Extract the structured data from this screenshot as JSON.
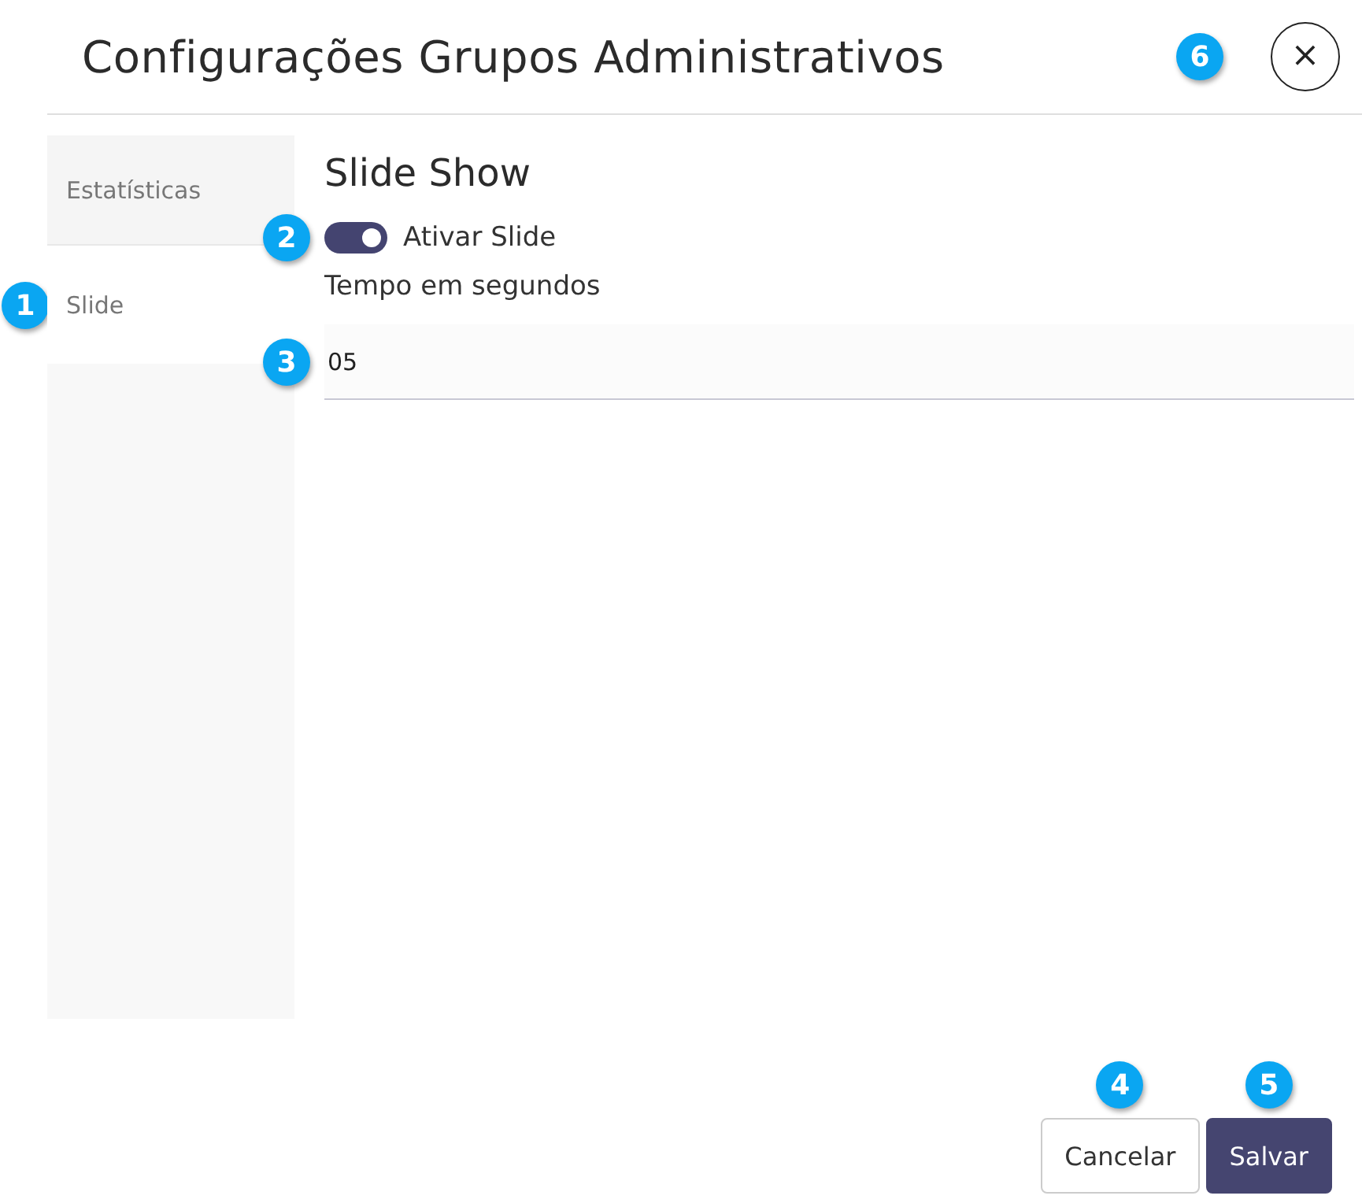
{
  "dialog": {
    "title": "Configurações Grupos Administrativos",
    "close": {
      "label": "×",
      "callout": "6"
    }
  },
  "tabs": [
    {
      "label": "Estatísticas",
      "selected": false
    },
    {
      "label": "Slide",
      "selected": true,
      "callout": "1"
    }
  ],
  "panel": {
    "heading": "Slide Show",
    "toggle": {
      "label": "Ativar Slide",
      "on": true,
      "callout": "2"
    },
    "field": {
      "label": "Tempo em segundos",
      "value": "05",
      "callout": "3"
    }
  },
  "buttons": [
    {
      "label": "Cancelar",
      "kind": "secondary",
      "callout": "4"
    },
    {
      "label": "Salvar",
      "kind": "primary",
      "callout": "5"
    }
  ]
}
